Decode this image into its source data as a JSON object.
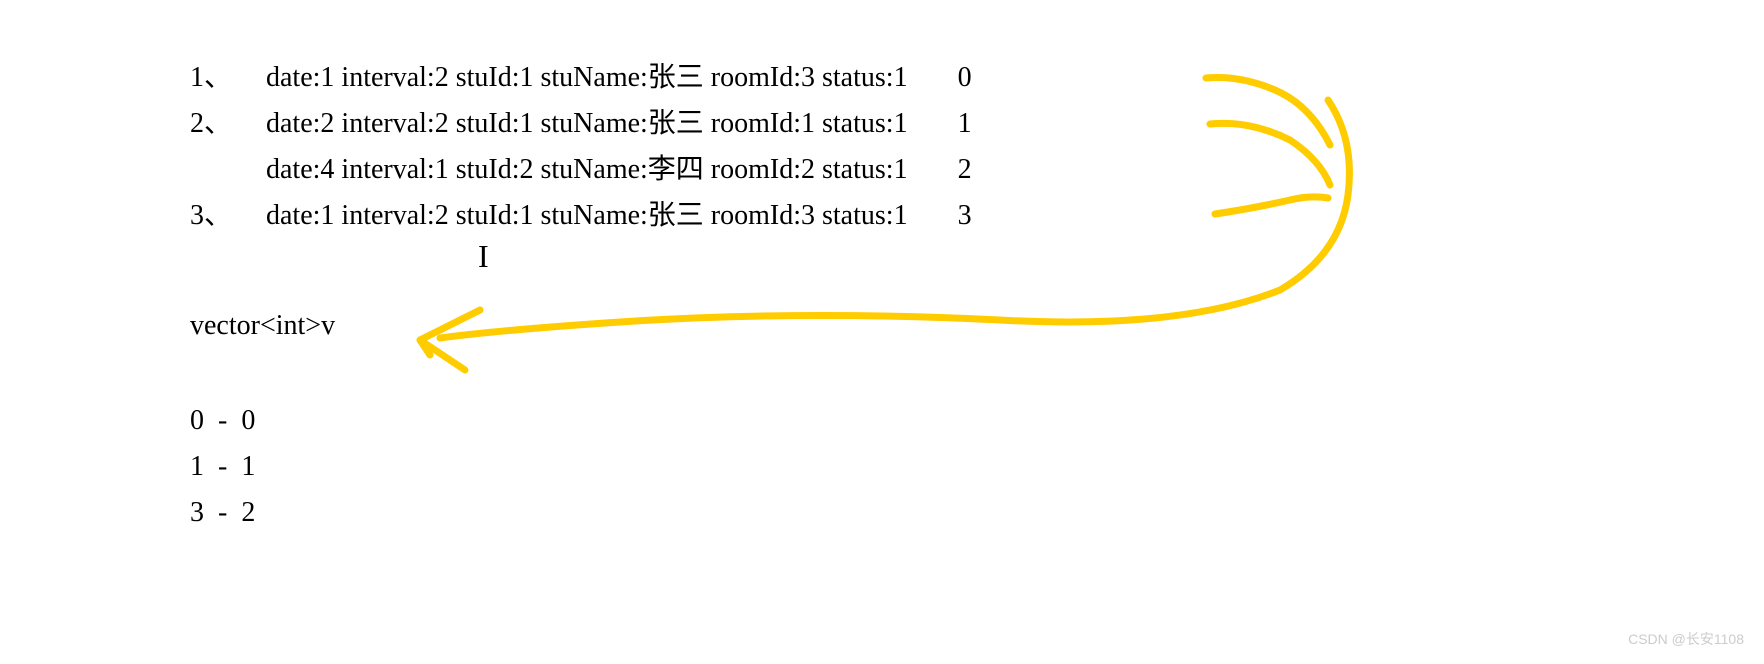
{
  "rows": [
    {
      "prefix": "1、",
      "date": "1",
      "interval": "2",
      "stuId": "1",
      "stuName": "张三",
      "roomId": "3",
      "status": "1",
      "index": "0"
    },
    {
      "prefix": "2、",
      "date": "2",
      "interval": "2",
      "stuId": "1",
      "stuName": "张三",
      "roomId": "1",
      "status": "1",
      "index": "1"
    },
    {
      "prefix": "",
      "date": "4",
      "interval": "1",
      "stuId": "2",
      "stuName": "李四",
      "roomId": "2",
      "status": "1",
      "index": "2"
    },
    {
      "prefix": "3、",
      "date": "1",
      "interval": "2",
      "stuId": "1",
      "stuName": "张三",
      "roomId": "3",
      "status": "1",
      "index": "3"
    }
  ],
  "vectorDecl": "vector<int>v",
  "mappings": [
    {
      "left": "0",
      "right": "0"
    },
    {
      "left": "1",
      "right": "1"
    },
    {
      "left": "3",
      "right": "2"
    }
  ],
  "watermark": "CSDN @长安1108",
  "annotation": {
    "color": "#ffcc00"
  }
}
